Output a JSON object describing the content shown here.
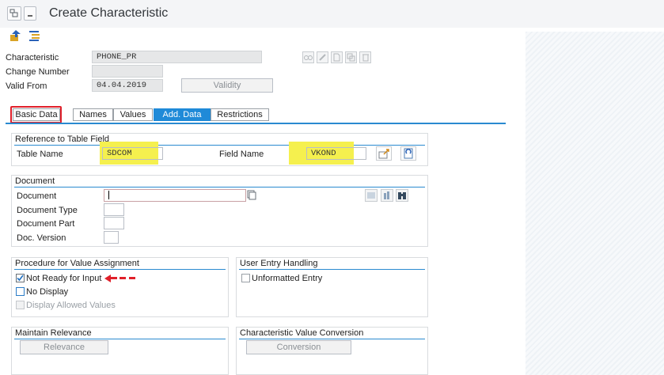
{
  "window": {
    "title": "Create Characteristic"
  },
  "header": {
    "characteristic_label": "Characteristic",
    "characteristic_value": "PHONE_PR",
    "change_number_label": "Change Number",
    "change_number_value": "",
    "valid_from_label": "Valid From",
    "valid_from_value": "04.04.2019",
    "validity_button": "Validity"
  },
  "tabs": [
    {
      "label": "Basic Data",
      "active": false,
      "highlighted": true
    },
    {
      "label": "Names",
      "active": false
    },
    {
      "label": "Values",
      "active": false
    },
    {
      "label": "Add. Data",
      "active": true
    },
    {
      "label": "Restrictions",
      "active": false
    }
  ],
  "reference": {
    "title": "Reference to Table Field",
    "table_name_label": "Table Name",
    "table_name_value": "SDCOM",
    "field_name_label": "Field Name",
    "field_name_value": "VKOND"
  },
  "document": {
    "title": "Document",
    "document_label": "Document",
    "document_type_label": "Document Type",
    "document_part_label": "Document Part",
    "doc_version_label": "Doc. Version"
  },
  "procedure": {
    "title": "Procedure for Value Assignment",
    "not_ready_label": "Not Ready for Input",
    "not_ready_checked": true,
    "no_display_label": "No Display",
    "no_display_checked": false,
    "display_allowed_label": "Display Allowed Values",
    "display_allowed_checked": false
  },
  "user_entry": {
    "title": "User Entry Handling",
    "unformatted_label": "Unformatted Entry",
    "unformatted_checked": false
  },
  "relevance": {
    "title": "Maintain Relevance",
    "button": "Relevance"
  },
  "conversion": {
    "title": "Characteristic Value Conversion",
    "button": "Conversion"
  },
  "colors": {
    "accent": "#1f8ad8",
    "highlight": "#f5f04e",
    "annotation_red": "#e0202a"
  }
}
